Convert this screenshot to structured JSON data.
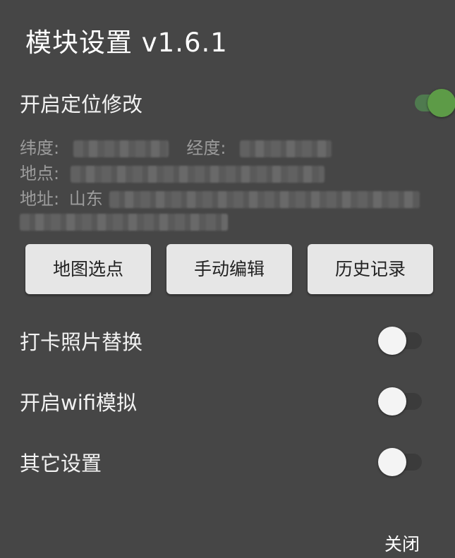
{
  "dialog": {
    "title": "模块设置  v1.6.1",
    "location_toggle": {
      "label": "开启定位修改",
      "on": true
    },
    "info": {
      "latitude_label": "纬度:",
      "longitude_label": "经度:",
      "place_label": "地点:",
      "address_label": "地址:",
      "address_prefix": "山东"
    },
    "buttons": {
      "map_pick": "地图选点",
      "manual_edit": "手动编辑",
      "history": "历史记录"
    },
    "settings": [
      {
        "label": "打卡照片替换",
        "on": false
      },
      {
        "label": "开启wifi模拟",
        "on": false
      },
      {
        "label": "其它设置",
        "on": false
      }
    ],
    "close_label": "关闭",
    "colors": {
      "background": "#464646",
      "switch_on": "#5d9b47",
      "button_bg": "#e6e6e6"
    }
  }
}
